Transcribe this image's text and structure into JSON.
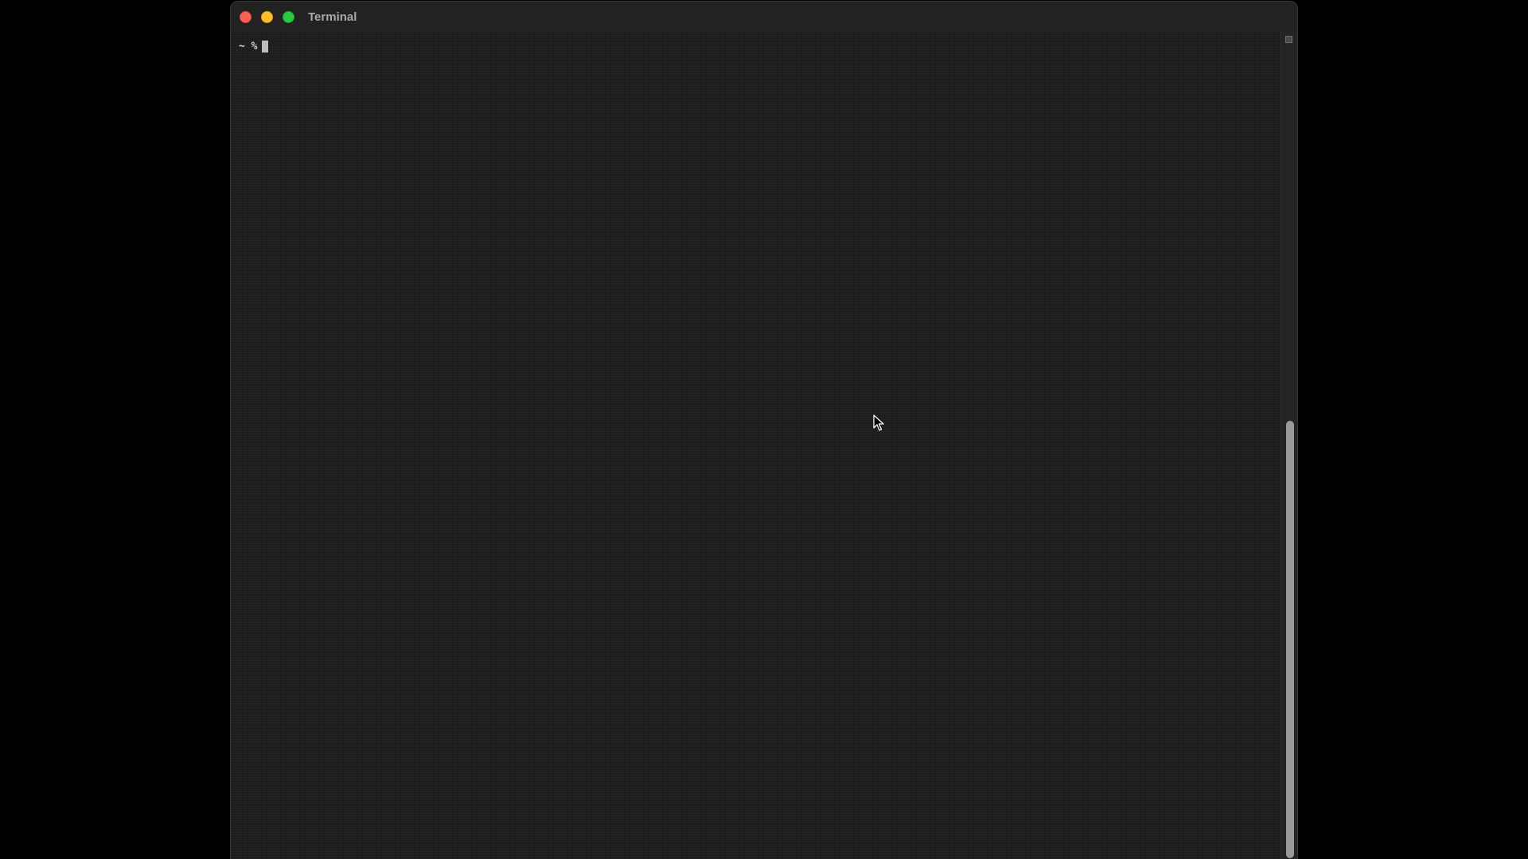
{
  "window": {
    "title": "Terminal"
  },
  "terminal": {
    "prompt": "~ %",
    "input": ""
  },
  "scrollbar": {
    "thumb_start_fraction": 0.47,
    "thumb_end_fraction": 1.0
  },
  "icons": {
    "close": "close-traffic-light-icon",
    "minimize": "minimize-traffic-light-icon",
    "zoom": "zoom-traffic-light-icon",
    "pointer": "mouse-pointer-icon"
  },
  "colors": {
    "desktop_background": "#000000",
    "terminal_background": "#1c1c1c",
    "traffic_close": "#fe5f57",
    "traffic_minimize": "#febc2e",
    "traffic_zoom": "#28c840",
    "prompt_text": "#d0d0d0",
    "title_text": "#a9a9a9"
  }
}
